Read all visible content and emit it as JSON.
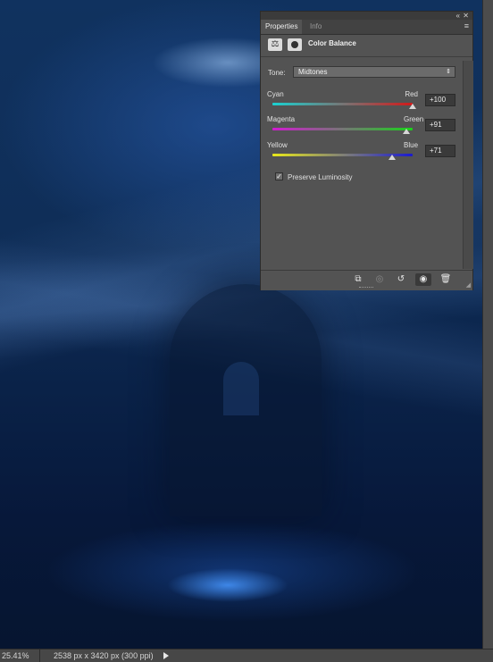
{
  "panel": {
    "tabs": [
      {
        "label": "Properties",
        "active": true
      },
      {
        "label": "Info",
        "active": false
      }
    ],
    "icons": {
      "collapse": "double-chevron-left-icon",
      "close": "close-icon",
      "menu": "panel-menu-icon",
      "adjustment": "scale-balance-icon",
      "mask": "layer-mask-icon"
    },
    "title": "Color Balance",
    "tone": {
      "label": "Tone:",
      "value": "Midtones"
    },
    "sliders": [
      {
        "left": "Cyan",
        "right": "Red",
        "value": 100,
        "display": "+100",
        "gradient": [
          "#1ad1d1",
          "#d21a1a"
        ]
      },
      {
        "left": "Magenta",
        "right": "Green",
        "value": 91,
        "display": "+91",
        "gradient": [
          "#d11ad1",
          "#1ad11a"
        ]
      },
      {
        "left": "Yellow",
        "right": "Blue",
        "value": 71,
        "display": "+71",
        "gradient": [
          "#e8e81a",
          "#1a1ad1"
        ]
      }
    ],
    "preserve_luminosity": {
      "label": "Preserve Luminosity",
      "checked": true
    },
    "footer_buttons": [
      "clip-to-layer-icon",
      "view-previous-state-icon",
      "reset-icon",
      "visibility-eye-icon",
      "trash-icon"
    ]
  },
  "status": {
    "zoom": "25.41%",
    "doc_info": "2538 px x 3420 px (300 ppi)"
  }
}
